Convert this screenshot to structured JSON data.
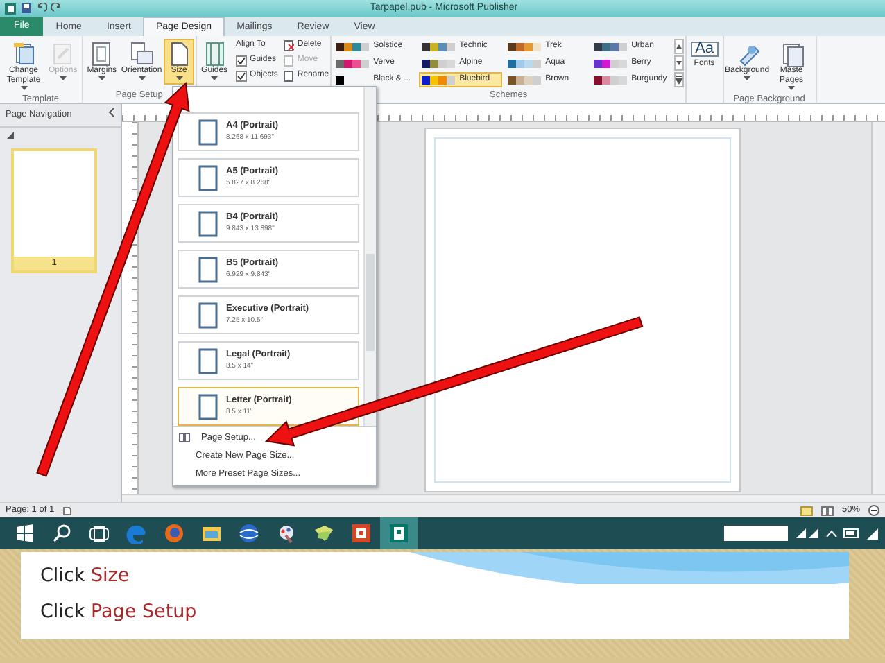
{
  "window": {
    "title": "Tarpapel.pub - Microsoft Publisher"
  },
  "tabs": [
    {
      "label": "File",
      "kind": "file",
      "selected": false
    },
    {
      "label": "Home",
      "kind": "tab",
      "selected": false
    },
    {
      "label": "Insert",
      "kind": "tab",
      "selected": false
    },
    {
      "label": "Page Design",
      "kind": "tab",
      "selected": true
    },
    {
      "label": "Mailings",
      "kind": "tab",
      "selected": false
    },
    {
      "label": "Review",
      "kind": "tab",
      "selected": false
    },
    {
      "label": "View",
      "kind": "tab",
      "selected": false
    }
  ],
  "ribbon": [
    {
      "label": "Template",
      "items": [
        {
          "kind": "big",
          "label": "Change Template",
          "disabled": false,
          "pressed": false
        },
        {
          "kind": "big",
          "label": "Options",
          "disabled": true,
          "pressed": false
        }
      ]
    },
    {
      "label": "Page Setup",
      "items": [
        {
          "kind": "big",
          "label": "Margins",
          "disabled": false,
          "pressed": false
        },
        {
          "kind": "big",
          "label": "Orientation",
          "disabled": false,
          "pressed": false
        },
        {
          "kind": "big",
          "label": "Size",
          "disabled": false,
          "pressed": true
        }
      ]
    },
    {
      "items": [
        {
          "kind": "big",
          "label": "Guides",
          "disabled": false,
          "pressed": false
        },
        {
          "kind": "stack",
          "rows": [
            {
              "kind": "label",
              "label": "Align To"
            },
            {
              "kind": "check",
              "label": "Guides",
              "checked": true
            },
            {
              "kind": "check",
              "label": "Objects",
              "checked": true
            }
          ]
        },
        {
          "kind": "stack",
          "rows": [
            {
              "kind": "small",
              "label": "Delete",
              "disabled": false
            },
            {
              "kind": "small",
              "label": "Move",
              "disabled": true
            },
            {
              "kind": "small",
              "label": "Rename",
              "disabled": false
            }
          ]
        }
      ]
    },
    {
      "label": "Schemes",
      "items": [
        {
          "kind": "schemes",
          "schemes": [
            {
              "name": "Solstice",
              "swatches": [
                {
                  "color": "#3b1f14"
                },
                {
                  "color": "#d9891a"
                },
                {
                  "color": "#2c8a9c"
                },
                {
                  "color": "#cfcfcf"
                }
              ],
              "selected": false
            },
            {
              "name": "Technic",
              "swatches": [
                {
                  "color": "#333333"
                },
                {
                  "color": "#c9b323"
                },
                {
                  "color": "#5a8fb3"
                },
                {
                  "color": "#cfcfcf"
                }
              ],
              "selected": false
            },
            {
              "name": "Trek",
              "swatches": [
                {
                  "color": "#5a3a1e"
                },
                {
                  "color": "#c06a2a"
                },
                {
                  "color": "#e39a35"
                },
                {
                  "color": "#efe3c8"
                }
              ],
              "selected": false
            },
            {
              "name": "Urban",
              "swatches": [
                {
                  "color": "#333a48"
                },
                {
                  "color": "#3f6f86"
                },
                {
                  "color": "#5b76a8"
                },
                {
                  "color": "#cfcfcf"
                }
              ],
              "selected": false
            },
            {
              "name": "Verve",
              "swatches": [
                {
                  "color": "#6b6b6b"
                },
                {
                  "color": "#d0186e"
                },
                {
                  "color": "#e9508f"
                },
                {
                  "color": "#cfcfcf"
                }
              ],
              "selected": false
            },
            {
              "name": "Alpine",
              "swatches": [
                {
                  "color": "#141a60"
                },
                {
                  "color": "#8f8f3c"
                },
                {
                  "color": "#cfcfcf"
                },
                {
                  "color": "#d8d8d8"
                }
              ],
              "selected": false
            },
            {
              "name": "Aqua",
              "swatches": [
                {
                  "color": "#1f6e9e"
                },
                {
                  "color": "#9fcbe8"
                },
                {
                  "color": "#b8d9ee"
                },
                {
                  "color": "#cfcfcf"
                }
              ],
              "selected": false
            },
            {
              "name": "Berry",
              "swatches": [
                {
                  "color": "#6633cc"
                },
                {
                  "color": "#d01ad0"
                },
                {
                  "color": "#cfcfcf"
                },
                {
                  "color": "#d8d8d8"
                }
              ],
              "selected": false
            },
            {
              "name": "Black & ...",
              "swatches": [
                {
                  "color": "#000000"
                }
              ],
              "selected": false
            },
            {
              "name": "Bluebird",
              "swatches": [
                {
                  "color": "#0a1fd0"
                },
                {
                  "color": "#f5c400"
                },
                {
                  "color": "#f08a00"
                },
                {
                  "color": "#cfcfcf"
                }
              ],
              "selected": true
            },
            {
              "name": "Brown",
              "swatches": [
                {
                  "color": "#7a5426"
                },
                {
                  "color": "#c8b293"
                },
                {
                  "color": "#ddd2bf"
                },
                {
                  "color": "#cfcfcf"
                }
              ],
              "selected": false
            },
            {
              "name": "Burgundy",
              "swatches": [
                {
                  "color": "#8a0f2a"
                },
                {
                  "color": "#d98aa0"
                },
                {
                  "color": "#cfcfcf"
                },
                {
                  "color": "#d8d8d8"
                }
              ],
              "selected": false
            }
          ]
        }
      ]
    },
    {
      "items": [
        {
          "kind": "font",
          "glyph": "Aa",
          "label": "Fonts",
          "disabled": false,
          "pressed": false
        }
      ]
    },
    {
      "label": "Page Background",
      "items": [
        {
          "kind": "big",
          "label": "Background",
          "disabled": false,
          "pressed": false
        },
        {
          "kind": "big",
          "label": "Maste Pages",
          "disabled": false,
          "pressed": false
        }
      ]
    }
  ],
  "navigation": {
    "title": "Page Navigation",
    "pages": [
      {
        "label": "1",
        "selected": true
      }
    ]
  },
  "size_menu": {
    "sizes": [
      {
        "name": "A4 (Portrait)",
        "dims": "8.268 x 11.693\"",
        "selected": false
      },
      {
        "name": "A5 (Portrait)",
        "dims": "5.827 x 8.268\"",
        "selected": false
      },
      {
        "name": "B4 (Portrait)",
        "dims": "9.843 x 13.898\"",
        "selected": false
      },
      {
        "name": "B5 (Portrait)",
        "dims": "6.929 x 9.843\"",
        "selected": false
      },
      {
        "name": "Executive (Portrait)",
        "dims": "7.25 x 10.5\"",
        "selected": false
      },
      {
        "name": "Legal (Portrait)",
        "dims": "8.5 x 14\"",
        "selected": false
      },
      {
        "name": "Letter (Portrait)",
        "dims": "8.5 x 11\"",
        "selected": true
      }
    ],
    "commands": [
      "Page Setup...",
      "Create New Page Size...",
      "More Preset Page Sizes..."
    ]
  },
  "status_bar": {
    "page": "Page: 1 of 1",
    "zoom": "50%"
  },
  "taskbar": [
    {
      "kind": "start",
      "selected": false
    },
    {
      "kind": "search",
      "selected": false
    },
    {
      "kind": "taskview",
      "selected": false
    },
    {
      "kind": "edge",
      "selected": false
    },
    {
      "kind": "firefox",
      "selected": false
    },
    {
      "kind": "files",
      "selected": false
    },
    {
      "kind": "globe",
      "selected": false
    },
    {
      "kind": "paint",
      "selected": false
    },
    {
      "kind": "folder",
      "selected": false
    },
    {
      "kind": "powerpoint",
      "selected": false
    },
    {
      "kind": "publisher",
      "selected": true
    }
  ],
  "instructions": [
    {
      "text": "Click",
      "highlight": "Size"
    },
    {
      "text": "Click",
      "highlight": "Page Setup"
    }
  ]
}
